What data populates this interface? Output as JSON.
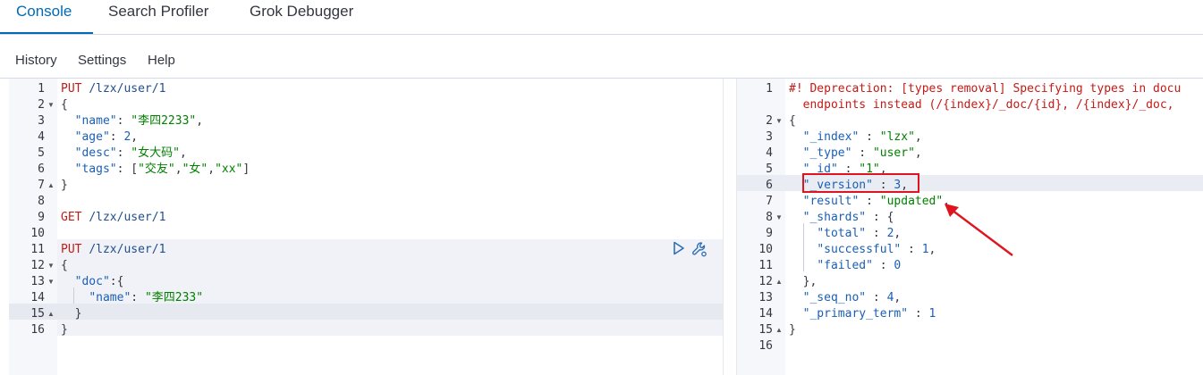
{
  "tabs": [
    "Console",
    "Search Profiler",
    "Grok Debugger"
  ],
  "menu": [
    "History",
    "Settings",
    "Help"
  ],
  "request": {
    "line_numbers": [
      "1",
      "2",
      "3",
      "4",
      "5",
      "6",
      "7",
      "8",
      "9",
      "10",
      "11",
      "12",
      "13",
      "14",
      "15",
      "16"
    ],
    "lines": [
      [
        [
          "red",
          "PUT "
        ],
        [
          "navy",
          "/lzx/user/1"
        ]
      ],
      [
        [
          "plain",
          "{"
        ]
      ],
      [
        [
          "plain",
          "  "
        ],
        [
          "blue",
          "\"name\""
        ],
        [
          "plain",
          ": "
        ],
        [
          "green",
          "\"李四2233\""
        ],
        [
          "plain",
          ","
        ]
      ],
      [
        [
          "plain",
          "  "
        ],
        [
          "blue",
          "\"age\""
        ],
        [
          "plain",
          ": "
        ],
        [
          "blue",
          "2"
        ],
        [
          "plain",
          ","
        ]
      ],
      [
        [
          "plain",
          "  "
        ],
        [
          "blue",
          "\"desc\""
        ],
        [
          "plain",
          ": "
        ],
        [
          "green",
          "\"女大码\""
        ],
        [
          "plain",
          ","
        ]
      ],
      [
        [
          "plain",
          "  "
        ],
        [
          "blue",
          "\"tags\""
        ],
        [
          "plain",
          ": ["
        ],
        [
          "green",
          "\"交友\""
        ],
        [
          "plain",
          ","
        ],
        [
          "green",
          "\"女\""
        ],
        [
          "plain",
          ","
        ],
        [
          "green",
          "\"xx\""
        ],
        [
          "plain",
          "]"
        ]
      ],
      [
        [
          "plain",
          "}"
        ]
      ],
      [],
      [
        [
          "red",
          "GET "
        ],
        [
          "navy",
          "/lzx/user/1"
        ]
      ],
      [],
      [
        [
          "red",
          "PUT "
        ],
        [
          "navy",
          "/lzx/user/1"
        ]
      ],
      [
        [
          "plain",
          "{"
        ]
      ],
      [
        [
          "plain",
          "  "
        ],
        [
          "blue",
          "\"doc\""
        ],
        [
          "plain",
          ":{"
        ]
      ],
      [
        [
          "plain",
          "    "
        ],
        [
          "blue",
          "\"name\""
        ],
        [
          "plain",
          ": "
        ],
        [
          "green",
          "\"李四233\""
        ]
      ],
      [
        [
          "plain",
          "  }"
        ]
      ],
      [
        [
          "plain",
          "}"
        ]
      ]
    ]
  },
  "response": {
    "line_numbers": [
      "1",
      "",
      "2",
      "3",
      "4",
      "5",
      "6",
      "7",
      "8",
      "9",
      "10",
      "11",
      "12",
      "13",
      "14",
      "15",
      "16"
    ],
    "lines": [
      [
        [
          "red",
          "#! Deprecation: [types removal] Specifying types in docu"
        ]
      ],
      [
        [
          "red",
          "  endpoints instead (/{index}/_doc/{id}, /{index}/_doc,"
        ]
      ],
      [
        [
          "plain",
          "{"
        ]
      ],
      [
        [
          "plain",
          "  "
        ],
        [
          "blue",
          "\"_index\""
        ],
        [
          "plain",
          " : "
        ],
        [
          "green",
          "\"lzx\""
        ],
        [
          "plain",
          ","
        ]
      ],
      [
        [
          "plain",
          "  "
        ],
        [
          "blue",
          "\"_type\""
        ],
        [
          "plain",
          " : "
        ],
        [
          "green",
          "\"user\""
        ],
        [
          "plain",
          ","
        ]
      ],
      [
        [
          "plain",
          "  "
        ],
        [
          "blue",
          "\"_id\""
        ],
        [
          "plain",
          " : "
        ],
        [
          "green",
          "\"1\""
        ],
        [
          "plain",
          ","
        ]
      ],
      [
        [
          "plain",
          "  "
        ],
        [
          "blue",
          "\"_version\""
        ],
        [
          "plain",
          " : "
        ],
        [
          "blue",
          "3"
        ],
        [
          "plain",
          ","
        ]
      ],
      [
        [
          "plain",
          "  "
        ],
        [
          "blue",
          "\"result\""
        ],
        [
          "plain",
          " : "
        ],
        [
          "green",
          "\"updated\""
        ],
        [
          "plain",
          ","
        ]
      ],
      [
        [
          "plain",
          "  "
        ],
        [
          "blue",
          "\"_shards\""
        ],
        [
          "plain",
          " : {"
        ]
      ],
      [
        [
          "plain",
          "    "
        ],
        [
          "blue",
          "\"total\""
        ],
        [
          "plain",
          " : "
        ],
        [
          "blue",
          "2"
        ],
        [
          "plain",
          ","
        ]
      ],
      [
        [
          "plain",
          "    "
        ],
        [
          "blue",
          "\"successful\""
        ],
        [
          "plain",
          " : "
        ],
        [
          "blue",
          "1"
        ],
        [
          "plain",
          ","
        ]
      ],
      [
        [
          "plain",
          "    "
        ],
        [
          "blue",
          "\"failed\""
        ],
        [
          "plain",
          " : "
        ],
        [
          "blue",
          "0"
        ]
      ],
      [
        [
          "plain",
          "  },"
        ]
      ],
      [
        [
          "plain",
          "  "
        ],
        [
          "blue",
          "\"_seq_no\""
        ],
        [
          "plain",
          " : "
        ],
        [
          "blue",
          "4"
        ],
        [
          "plain",
          ","
        ]
      ],
      [
        [
          "plain",
          "  "
        ],
        [
          "blue",
          "\"_primary_term\""
        ],
        [
          "plain",
          " : "
        ],
        [
          "blue",
          "1"
        ]
      ],
      [
        [
          "plain",
          "}"
        ]
      ],
      []
    ]
  },
  "icons": {
    "run": "play-icon",
    "settings": "wrench-icon"
  },
  "colors": {
    "accent": "#006bb4",
    "annotation": "#e0141e"
  }
}
